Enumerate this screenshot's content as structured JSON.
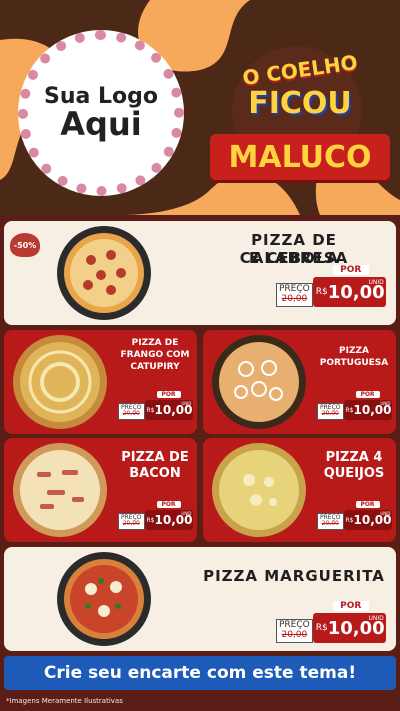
{
  "header": {
    "logo_line1": "Sua Logo",
    "logo_line2": "Aqui",
    "badge_line1": "O COELHO",
    "badge_line2": "FICOU",
    "badge_line3": "MALUCO"
  },
  "discount_badge": "-50%",
  "products": [
    {
      "name_line1": "PIZZA DE CALABRESA",
      "name_line2": "E CEBOLA",
      "preco_label": "PREÇO",
      "old_price": "20,00",
      "por_label": "POR",
      "currency": "R$",
      "price": "10,00",
      "unit": "UNID"
    },
    {
      "name_line1": "PIZZA DE",
      "name_line2": "FRANGO COM",
      "name_line3": "CATUPIRY",
      "preco_label": "PREÇO",
      "old_price": "20,00",
      "por_label": "POR",
      "currency": "R$",
      "price": "10,00",
      "unit": "UNID"
    },
    {
      "name_line1": "PIZZA",
      "name_line2": "PORTUGUESA",
      "preco_label": "PREÇO",
      "old_price": "20,00",
      "por_label": "POR",
      "currency": "R$",
      "price": "10,00",
      "unit": "UNID"
    },
    {
      "name_line1": "PIZZA DE",
      "name_line2": "BACON",
      "preco_label": "PREÇO",
      "old_price": "20,00",
      "por_label": "POR",
      "currency": "R$",
      "price": "10,00",
      "unit": "UNID"
    },
    {
      "name_line1": "PIZZA 4",
      "name_line2": "QUEIJOS",
      "preco_label": "PREÇO",
      "old_price": "20,00",
      "por_label": "POR",
      "currency": "R$",
      "price": "10,00",
      "unit": "UNID"
    },
    {
      "name_line1": "PIZZA MARGUERITA",
      "preco_label": "PREÇO",
      "old_price": "20,00",
      "por_label": "POR",
      "currency": "R$",
      "price": "10,00",
      "unit": "UNID"
    }
  ],
  "cta": "Crie seu encarte com este tema!",
  "footnote": "*Imagens Meramente Ilustrativas",
  "colors": {
    "accent_red": "#b81a1a",
    "background_orange": "#f6a95a",
    "cta_blue": "#1e5bb8",
    "panel_brown": "#5a1e16"
  }
}
